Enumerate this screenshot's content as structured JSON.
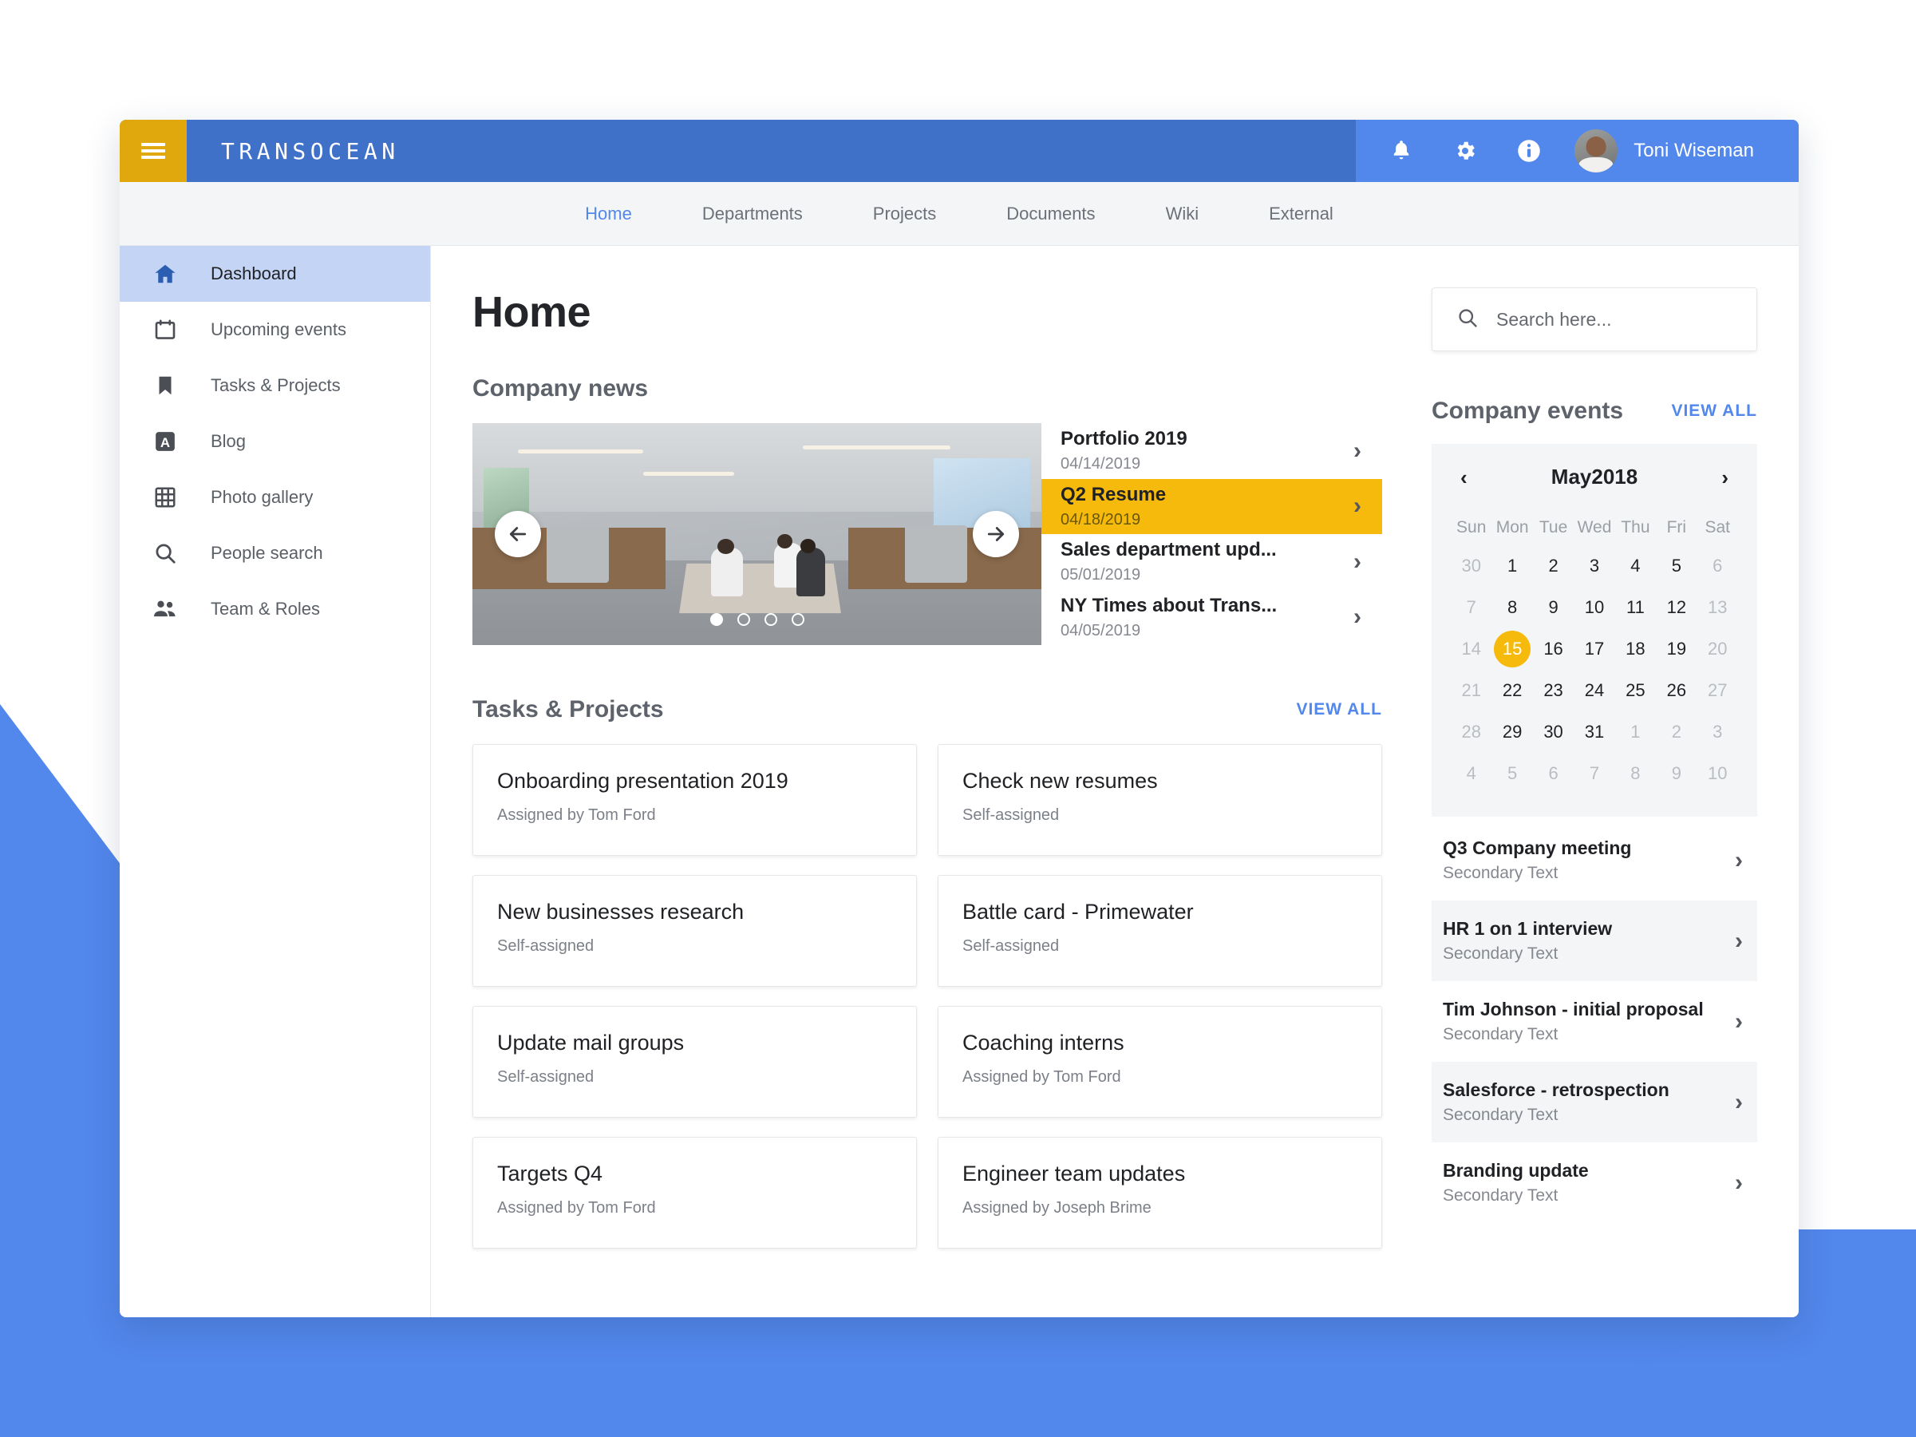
{
  "header": {
    "brand": "TRANSOCEAN",
    "menu_icon": "hamburger-icon",
    "icons": [
      {
        "name": "notifications-icon",
        "glyph": "bell"
      },
      {
        "name": "settings-icon",
        "glyph": "gear"
      },
      {
        "name": "info-icon",
        "glyph": "info"
      }
    ],
    "user_name": "Toni Wiseman",
    "bar_color_left": "#4071C9",
    "bar_color_right": "#5287EB",
    "menu_button_color": "#E0A80D"
  },
  "nav": {
    "tabs": [
      {
        "label": "Home",
        "active": true
      },
      {
        "label": "Departments",
        "active": false
      },
      {
        "label": "Projects",
        "active": false
      },
      {
        "label": "Documents",
        "active": false
      },
      {
        "label": "Wiki",
        "active": false
      },
      {
        "label": "External",
        "active": false
      }
    ],
    "active_color": "#5287EB"
  },
  "sidebar": {
    "items": [
      {
        "label": "Dashboard",
        "icon": "home-icon",
        "active": true
      },
      {
        "label": "Upcoming events",
        "icon": "calendar-icon",
        "active": false
      },
      {
        "label": "Tasks & Projects",
        "icon": "bookmark-icon",
        "active": false
      },
      {
        "label": "Blog",
        "icon": "blog-a-icon",
        "active": false
      },
      {
        "label": "Photo gallery",
        "icon": "grid-icon",
        "active": false
      },
      {
        "label": "People search",
        "icon": "search-icon",
        "active": false
      },
      {
        "label": "Team & Roles",
        "icon": "people-icon",
        "active": false
      }
    ],
    "active_background": "#C3D4F5"
  },
  "main": {
    "page_title": "Home",
    "news_section_title": "Company news",
    "carousel": {
      "prev_label": "←",
      "next_label": "→",
      "dots": 4,
      "active_dot": 1,
      "image_alt": "Open plan office with people working at a long table"
    },
    "news_items": [
      {
        "title": "Portfolio 2019",
        "date": "04/14/2019",
        "highlighted": false
      },
      {
        "title": "Q2 Resume",
        "date": "04/18/2019",
        "highlighted": true
      },
      {
        "title": "Sales department upd...",
        "date": "05/01/2019",
        "highlighted": false
      },
      {
        "title": "NY Times about Trans...",
        "date": "04/05/2019",
        "highlighted": false
      }
    ],
    "highlight_color": "#F5BA0C",
    "tasks_section_title": "Tasks & Projects",
    "tasks_view_all": "VIEW ALL",
    "tasks": [
      {
        "title": "Onboarding presentation 2019",
        "assignee": "Assigned by Tom Ford"
      },
      {
        "title": "Check new resumes",
        "assignee": "Self-assigned"
      },
      {
        "title": "New businesses research",
        "assignee": "Self-assigned"
      },
      {
        "title": "Battle card - Primewater",
        "assignee": "Self-assigned"
      },
      {
        "title": "Update mail groups",
        "assignee": "Self-assigned"
      },
      {
        "title": "Coaching interns",
        "assignee": "Assigned by Tom Ford"
      },
      {
        "title": "Targets Q4",
        "assignee": "Assigned by Tom Ford"
      },
      {
        "title": "Engineer team updates",
        "assignee": "Assigned by Joseph Brime"
      }
    ]
  },
  "rail": {
    "search_placeholder": "Search here...",
    "search_value": "",
    "events_title": "Company events",
    "events_view_all": "VIEW ALL",
    "calendar": {
      "month_label": "May2018",
      "prev_label": "‹",
      "next_label": "›",
      "weekdays": [
        "Sun",
        "Mon",
        "Tue",
        "Wed",
        "Thu",
        "Fri",
        "Sat"
      ],
      "selected_day": 15,
      "selected_color": "#F5BA0C",
      "weeks": [
        [
          {
            "d": 30,
            "mute": true
          },
          {
            "d": 1
          },
          {
            "d": 2
          },
          {
            "d": 3
          },
          {
            "d": 4
          },
          {
            "d": 5
          },
          {
            "d": 6,
            "mute": true
          }
        ],
        [
          {
            "d": 7,
            "mute": true
          },
          {
            "d": 8
          },
          {
            "d": 9
          },
          {
            "d": 10
          },
          {
            "d": 11
          },
          {
            "d": 12
          },
          {
            "d": 13,
            "mute": true
          }
        ],
        [
          {
            "d": 14,
            "mute": true
          },
          {
            "d": 15,
            "sel": true
          },
          {
            "d": 16
          },
          {
            "d": 17
          },
          {
            "d": 18
          },
          {
            "d": 19
          },
          {
            "d": 20,
            "mute": true
          }
        ],
        [
          {
            "d": 21,
            "mute": true
          },
          {
            "d": 22
          },
          {
            "d": 23
          },
          {
            "d": 24
          },
          {
            "d": 25
          },
          {
            "d": 26
          },
          {
            "d": 27,
            "mute": true
          }
        ],
        [
          {
            "d": 28,
            "mute": true
          },
          {
            "d": 29
          },
          {
            "d": 30
          },
          {
            "d": 31
          },
          {
            "d": 1,
            "mute": true
          },
          {
            "d": 2,
            "mute": true
          },
          {
            "d": 3,
            "mute": true
          }
        ],
        [
          {
            "d": 4,
            "mute": true
          },
          {
            "d": 5,
            "mute": true
          },
          {
            "d": 6,
            "mute": true
          },
          {
            "d": 7,
            "mute": true
          },
          {
            "d": 8,
            "mute": true
          },
          {
            "d": 9,
            "mute": true
          },
          {
            "d": 10,
            "mute": true
          }
        ]
      ]
    },
    "events": [
      {
        "title": "Q3 Company meeting",
        "secondary": "Secondary Text"
      },
      {
        "title": "HR 1 on 1 interview",
        "secondary": "Secondary Text"
      },
      {
        "title": "Tim Johnson - initial proposal",
        "secondary": "Secondary Text"
      },
      {
        "title": "Salesforce - retrospection",
        "secondary": "Secondary Text"
      },
      {
        "title": "Branding update",
        "secondary": "Secondary Text"
      }
    ]
  }
}
